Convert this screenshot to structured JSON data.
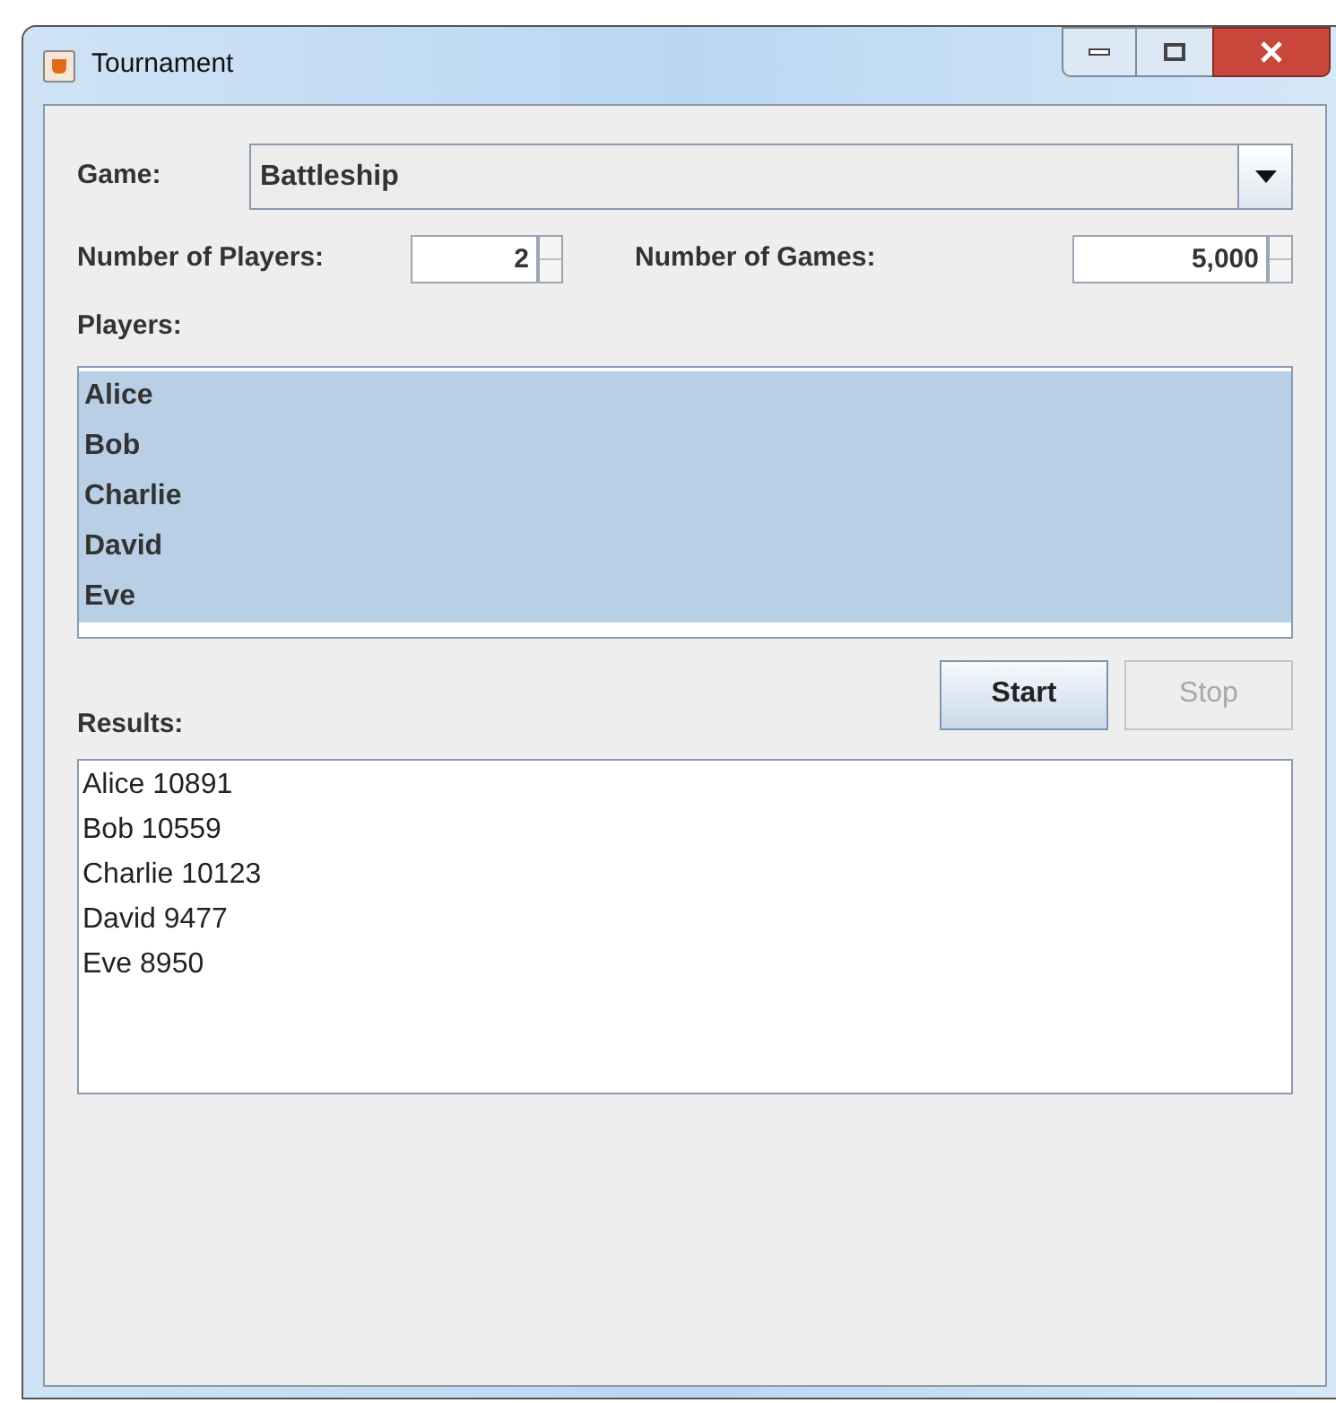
{
  "window": {
    "title": "Tournament"
  },
  "game": {
    "label": "Game:",
    "value": "Battleship"
  },
  "players_count": {
    "label": "Number of Players:",
    "value": "2"
  },
  "games_count": {
    "label": "Number of Games:",
    "value": "5,000"
  },
  "players": {
    "label": "Players:",
    "items": [
      {
        "name": "Alice",
        "selected": true
      },
      {
        "name": "Bob",
        "selected": true
      },
      {
        "name": "Charlie",
        "selected": true
      },
      {
        "name": "David",
        "selected": true
      },
      {
        "name": "Eve",
        "selected": true
      }
    ]
  },
  "buttons": [
    {
      "label": "Start",
      "disabled": false
    },
    {
      "label": "Stop",
      "disabled": true
    }
  ],
  "results": {
    "label": "Results:",
    "lines": [
      "Alice 10891",
      "Bob 10559",
      "Charlie 10123",
      "David 9477",
      "Eve 8950"
    ]
  }
}
